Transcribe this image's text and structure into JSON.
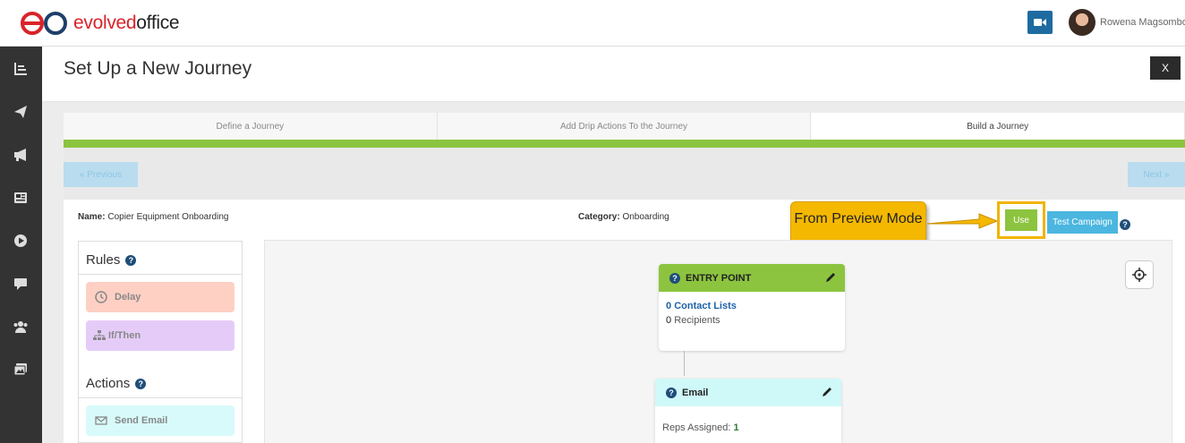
{
  "brand": {
    "logo_text_colored": "evolved",
    "logo_text_rest": "office",
    "accent": "#d9232a"
  },
  "header": {
    "user_name": "Rowena Magsombol"
  },
  "sidebar": {
    "items": [
      "analytics-icon",
      "send-icon",
      "megaphone-icon",
      "newspaper-icon",
      "play-icon",
      "chat-icon",
      "users-icon",
      "images-icon"
    ]
  },
  "page": {
    "title": "Set Up a New Journey",
    "close_label": "X"
  },
  "steps": [
    "Define a Journey",
    "Add Drip Actions To the Journey",
    "Build a Journey"
  ],
  "nav": {
    "previous_label": "« Previous",
    "next_label": "Next »"
  },
  "meta": {
    "name_label": "Name:",
    "name_value": "Copier Equipment Onboarding",
    "category_label": "Category:",
    "category_value": "Onboarding"
  },
  "buttons": {
    "use_label": "Use",
    "test_label": "Test Campaign"
  },
  "callout": {
    "text": "From Preview Mode"
  },
  "rules_panel": {
    "rules_title": "Rules",
    "rules": [
      {
        "label": "Delay",
        "color": "#fdd0c3"
      },
      {
        "label": "If/Then",
        "color": "#e5ccf8"
      }
    ],
    "actions_title": "Actions",
    "actions": [
      {
        "label": "Send Email",
        "color": "#d8fafa"
      }
    ]
  },
  "nodes": {
    "entry": {
      "title": "ENTRY POINT",
      "contact_lists_count": "0",
      "contact_lists_label": "Contact Lists",
      "recipients_count": "0",
      "recipients_label": "Recipients",
      "color": "#8cc43f"
    },
    "email": {
      "title": "Email",
      "reps_label": "Reps Assigned:",
      "reps_value": "1",
      "color": "#cff9f9"
    }
  },
  "help_symbol": "?"
}
